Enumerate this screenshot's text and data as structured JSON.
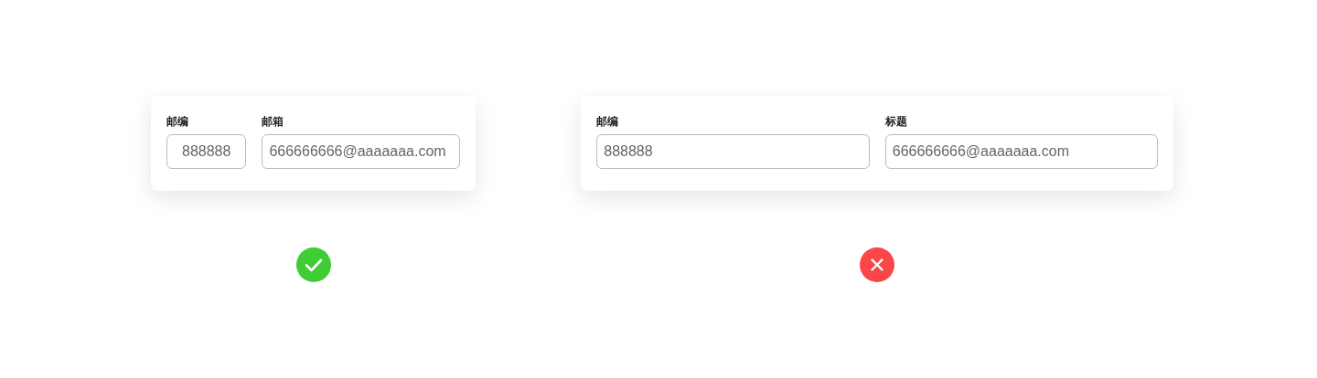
{
  "examples": [
    {
      "kind": "correct",
      "fields": [
        {
          "label": "邮编",
          "value": "888888"
        },
        {
          "label": "邮箱",
          "value": "666666666@aaaaaaa.com"
        }
      ]
    },
    {
      "kind": "incorrect",
      "fields": [
        {
          "label": "邮编",
          "value": "888888"
        },
        {
          "label": "标题",
          "value": "666666666@aaaaaaa.com"
        }
      ]
    }
  ]
}
